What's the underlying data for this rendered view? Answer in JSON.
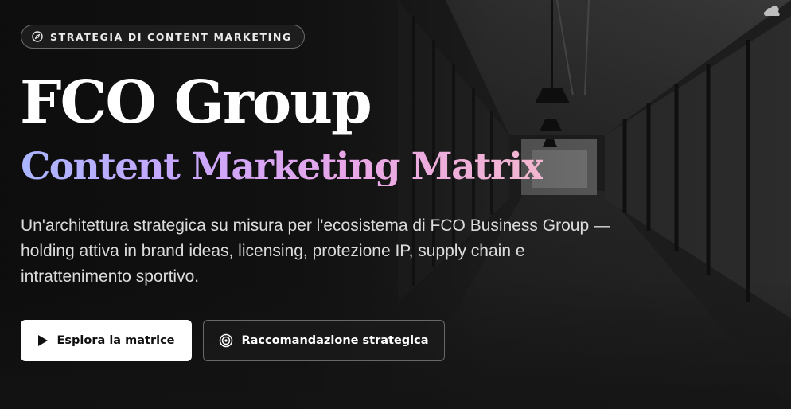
{
  "badge": {
    "icon": "compass-icon",
    "label": "STRATEGIA DI CONTENT MARKETING"
  },
  "hero": {
    "title": "FCO Group",
    "subtitle": "Content Marketing Matrix",
    "description": "Un'architettura strategica su misura per l'ecosistema di FCO Business Group — holding attiva in brand ideas, licensing, protezione IP, supply chain e intrattenimento sportivo."
  },
  "actions": {
    "primary": {
      "label": "Esplora la matrice",
      "icon": "play-icon"
    },
    "secondary": {
      "label": "Raccomandazione strategica",
      "icon": "target-icon"
    }
  },
  "colors": {
    "subtitle_gradient": [
      "#aab6ff",
      "#c7a6ff",
      "#e8a6e8",
      "#f2b6cf"
    ],
    "primary_button_bg": "#ffffff",
    "background": "#141414"
  }
}
